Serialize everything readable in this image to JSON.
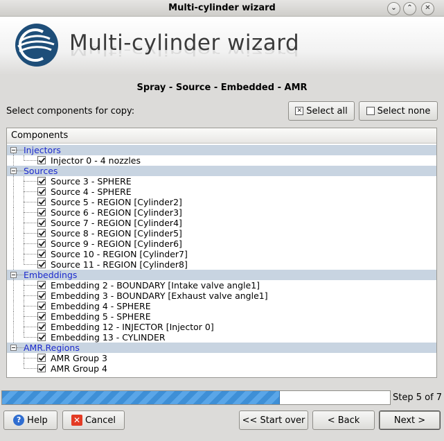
{
  "window": {
    "title": "Multi-cylinder wizard",
    "minimize_glyph": "⌄",
    "maximize_glyph": "⌃",
    "close_glyph": "✕"
  },
  "header": {
    "title": "Multi-cylinder wizard",
    "logo_icon": "converge-logo-icon"
  },
  "step_heading": "Spray - Source - Embedded - AMR",
  "select": {
    "label": "Select components for copy:",
    "select_all": "Select all",
    "select_none": "Select none",
    "select_all_glyph": "✕"
  },
  "tree": {
    "header": "Components",
    "groups": [
      {
        "label": "Injectors",
        "items": [
          {
            "label": "Injector 0 - 4 nozzles",
            "checked": true
          }
        ]
      },
      {
        "label": "Sources",
        "items": [
          {
            "label": "Source 3 - SPHERE",
            "checked": true
          },
          {
            "label": "Source 4 - SPHERE",
            "checked": true
          },
          {
            "label": "Source 5 - REGION [Cylinder2]",
            "checked": true
          },
          {
            "label": "Source 6 - REGION [Cylinder3]",
            "checked": true
          },
          {
            "label": "Source 7 - REGION [Cylinder4]",
            "checked": true
          },
          {
            "label": "Source 8 - REGION [Cylinder5]",
            "checked": true
          },
          {
            "label": "Source 9 - REGION [Cylinder6]",
            "checked": true
          },
          {
            "label": "Source 10 - REGION [Cylinder7]",
            "checked": true
          },
          {
            "label": "Source 11 - REGION [Cylinder8]",
            "checked": true
          }
        ]
      },
      {
        "label": "Embeddings",
        "items": [
          {
            "label": "Embedding 2 - BOUNDARY [Intake valve angle1]",
            "checked": true
          },
          {
            "label": "Embedding 3 - BOUNDARY [Exhaust valve angle1]",
            "checked": true
          },
          {
            "label": "Embedding 4 - SPHERE",
            "checked": true
          },
          {
            "label": "Embedding 5 - SPHERE",
            "checked": true
          },
          {
            "label": "Embedding 12 - INJECTOR [Injector 0]",
            "checked": true
          },
          {
            "label": "Embedding 13 - CYLINDER",
            "checked": true
          }
        ]
      },
      {
        "label": "AMR.Regions",
        "items": [
          {
            "label": "AMR Group 3",
            "checked": true
          },
          {
            "label": "AMR Group 4",
            "checked": true
          }
        ]
      }
    ]
  },
  "progress": {
    "fraction": 0.714,
    "step_text": "Step 5 of 7"
  },
  "buttons": {
    "help": "Help",
    "help_glyph": "?",
    "cancel": "Cancel",
    "cancel_glyph": "✕",
    "start_over": "<< Start over",
    "back": "< Back",
    "next": "Next >"
  },
  "colors": {
    "group_row_bg": "#c8d4e1",
    "group_label": "#1b2acd",
    "progress_fill": "#3e8fd6",
    "logo_bg": "#1e4e79"
  }
}
